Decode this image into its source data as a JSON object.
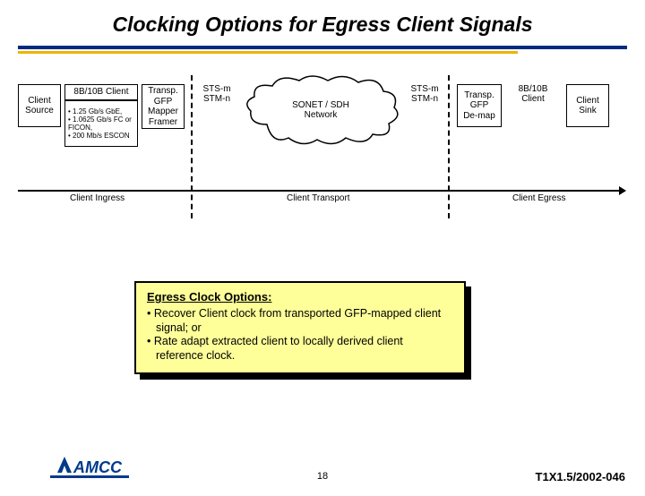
{
  "title": "Clocking Options for Egress Client Signals",
  "diagram": {
    "client_source": "Client\nSource",
    "client_8b10b": "8B/10B Client",
    "client_rates": "• 1.25 Gb/s GbE,\n• 1.0625 Gb/s FC or FICON,\n• 200 Mb/s ESCON",
    "gfp_mapper": "Transp.\nGFP\nMapper\nFramer",
    "sts_left": "STS-m\nSTM-n",
    "cloud": "SONET / SDH\nNetwork",
    "sts_right": "STS-m\nSTM-n",
    "gfp_demap": "Transp.\nGFP\nDe-map",
    "client_8b10b_out": "8B/10B\nClient",
    "client_sink": "Client\nSink",
    "stage_ingress": "Client Ingress",
    "stage_transport": "Client Transport",
    "stage_egress": "Client Egress"
  },
  "options": {
    "header": "Egress Clock Options:",
    "items": [
      "• Recover Client clock from transported GFP-mapped client signal; or",
      "• Rate adapt extracted client to locally derived client reference clock."
    ]
  },
  "footer": {
    "page": "18",
    "docid": "T1X1.5/2002-046",
    "logo": "AMCC"
  }
}
